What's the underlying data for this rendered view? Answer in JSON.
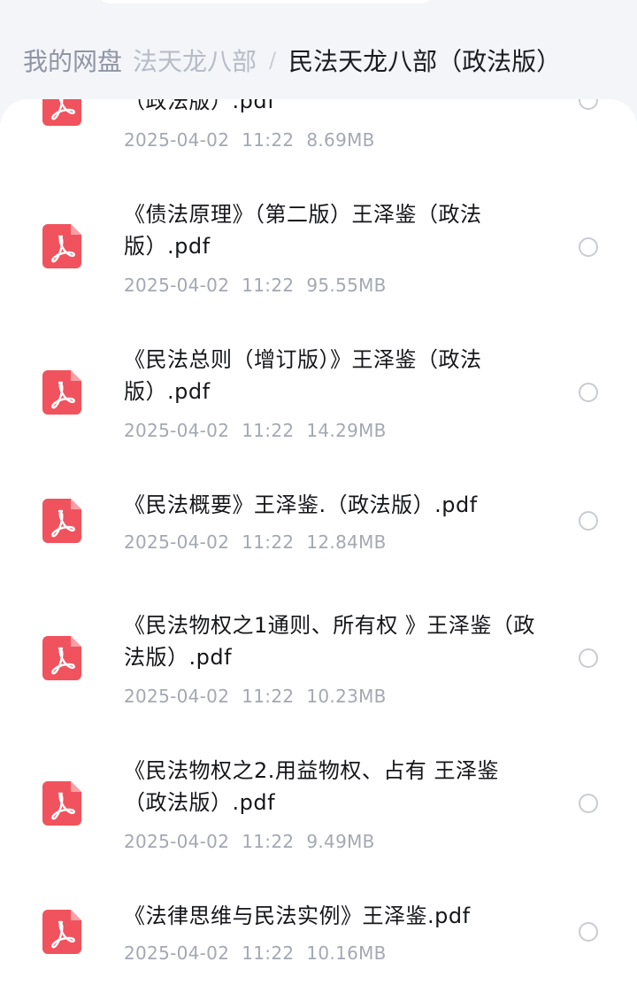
{
  "breadcrumb": {
    "root": "我的网盘",
    "parent": "法天龙八部",
    "separator": "/",
    "current": "民法天龙八部（政法版）"
  },
  "files": [
    {
      "title": "（政法版）.pdf",
      "date": "2025-04-02",
      "time": "11:22",
      "size": "8.69MB"
    },
    {
      "title": "《债法原理》（第二版）王泽鉴（政法版）.pdf",
      "date": "2025-04-02",
      "time": "11:22",
      "size": "95.55MB"
    },
    {
      "title": "《民法总则（增订版）》王泽鉴（政法版）.pdf",
      "date": "2025-04-02",
      "time": "11:22",
      "size": "14.29MB"
    },
    {
      "title": "《民法概要》王泽鉴.（政法版）.pdf",
      "date": "2025-04-02",
      "time": "11:22",
      "size": "12.84MB"
    },
    {
      "title": "《民法物权之1通则、所有权 》王泽鉴（政法版）.pdf",
      "date": "2025-04-02",
      "time": "11:22",
      "size": "10.23MB"
    },
    {
      "title": "《民法物权之2.用益物权、占有 王泽鉴（政法版）.pdf",
      "date": "2025-04-02",
      "time": "11:22",
      "size": "9.49MB"
    },
    {
      "title": "《法律思维与民法实例》王泽鉴.pdf",
      "date": "2025-04-02",
      "time": "11:22",
      "size": "10.16MB"
    }
  ],
  "colors": {
    "pdf_icon": "#f0535d",
    "meta_text": "#a3a8b3",
    "title_text": "#15161a"
  },
  "icons": {
    "file_type": "pdf-icon",
    "select": "radio-icon"
  }
}
